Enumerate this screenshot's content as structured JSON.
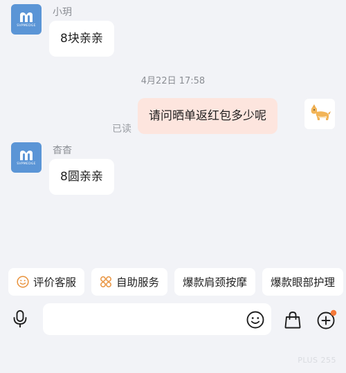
{
  "messages": [
    {
      "sender": "小玥",
      "text": "8块亲亲",
      "avatar_text": "SVPMEDGE"
    },
    {
      "timestamp": "4月22日 17:58"
    },
    {
      "text": "请问晒单返红包多少呢",
      "status": "已读"
    },
    {
      "sender": "杳杳",
      "text": "8圆亲亲",
      "avatar_text": "SVPMEDGE"
    }
  ],
  "quick_replies": [
    {
      "label": "评价客服",
      "icon": "smiley-icon"
    },
    {
      "label": "自助服务",
      "icon": "grid-flower-icon"
    },
    {
      "label": "爆款肩颈按摩"
    },
    {
      "label": "爆款眼部护理"
    }
  ],
  "input": {
    "placeholder": ""
  },
  "watermark": "PLUS 255",
  "colors": {
    "background": "#f2f3f7",
    "incoming_bubble": "#ffffff",
    "outgoing_bubble": "#fde5de",
    "avatar_blue": "#5b95d6",
    "notification_dot": "#f5793a",
    "chip_icon_orange": "#e8913a"
  }
}
